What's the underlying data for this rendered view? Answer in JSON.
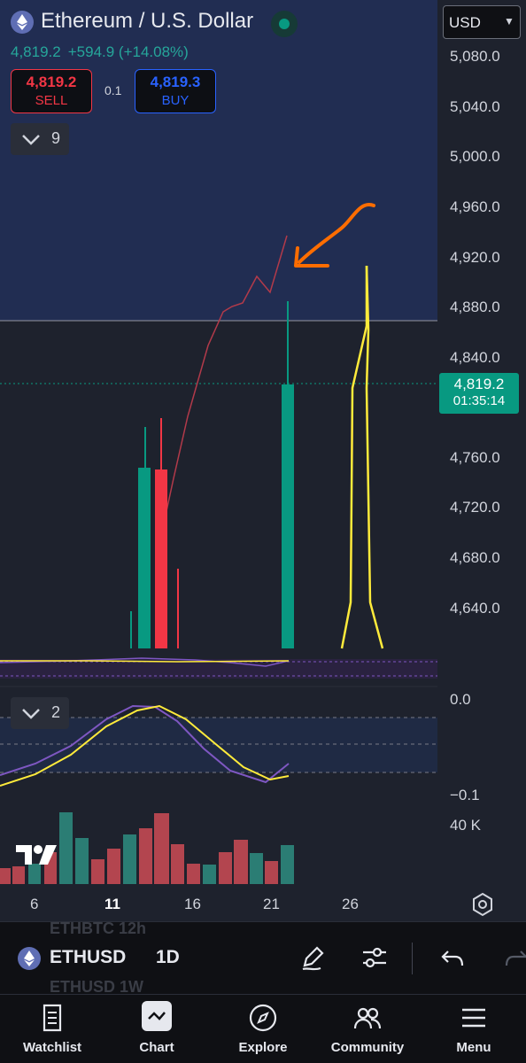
{
  "header": {
    "title": "Ethereum / U.S. Dollar",
    "last_price": "4,819.2",
    "change": "+594.9 (+14.08%)",
    "currency": "USD"
  },
  "trade": {
    "sell_price": "4,819.2",
    "sell_label": "SELL",
    "spread": "0.1",
    "buy_price": "4,819.3",
    "buy_label": "BUY"
  },
  "indicators_count": "9",
  "oscillator_count": "2",
  "price_axis": {
    "ticks": [
      "5,080.0",
      "5,040.0",
      "5,000.0",
      "4,960.0",
      "4,920.0",
      "4,880.0",
      "4,840.0",
      "4,760.0",
      "4,720.0",
      "4,680.0",
      "4,640.0"
    ],
    "current_price": "4,819.2",
    "countdown": "01:35:14"
  },
  "oscillator_axis": {
    "top": "0.0",
    "bottom": "−0.1",
    "volume": "40 K"
  },
  "date_ticks": [
    "6",
    "11",
    "16",
    "21",
    "26"
  ],
  "symbol_bar": {
    "symbol": "ETHUSD",
    "interval": "1D",
    "ghost_above": "ETHBTC   12h",
    "ghost_below": "ETHUSD   1W"
  },
  "nav": [
    {
      "label": "Watchlist",
      "icon": "watchlist-icon"
    },
    {
      "label": "Chart",
      "icon": "chart-icon"
    },
    {
      "label": "Explore",
      "icon": "compass-icon"
    },
    {
      "label": "Community",
      "icon": "community-icon"
    },
    {
      "label": "Menu",
      "icon": "menu-icon"
    }
  ],
  "colors": {
    "up": "#089981",
    "down": "#f23645",
    "buy": "#2962ff",
    "annotation": "#ff6d00",
    "highlight": "#ffeb3b"
  }
}
